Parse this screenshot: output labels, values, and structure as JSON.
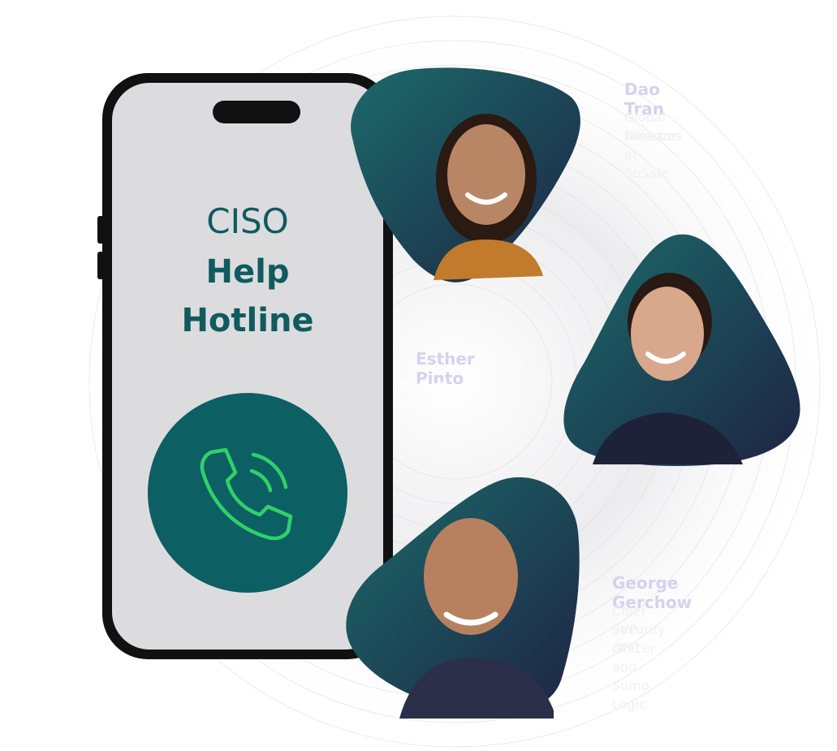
{
  "phone": {
    "line1": "CISO",
    "line2": "Help",
    "line3": "Hotline"
  },
  "icons": {
    "call": "phone-call-icon"
  },
  "people": [
    {
      "name": "Dao Tran",
      "role_line1": "Global Alliances",
      "role_line2": "Director at SoSafe"
    },
    {
      "name": "Esther Pinto",
      "role_line1": "CISO at anecdotes",
      "role_line2": ""
    },
    {
      "name": "George Gerchow",
      "role_line1": "Chief Security Officer and",
      "role_line2": "SVP of IT at Sumo Logic"
    }
  ],
  "colors": {
    "accent": "#0f5b5e",
    "call_bg": "#0c5f63",
    "call_icon": "#2fd16a",
    "name": "#d5d2ee"
  }
}
